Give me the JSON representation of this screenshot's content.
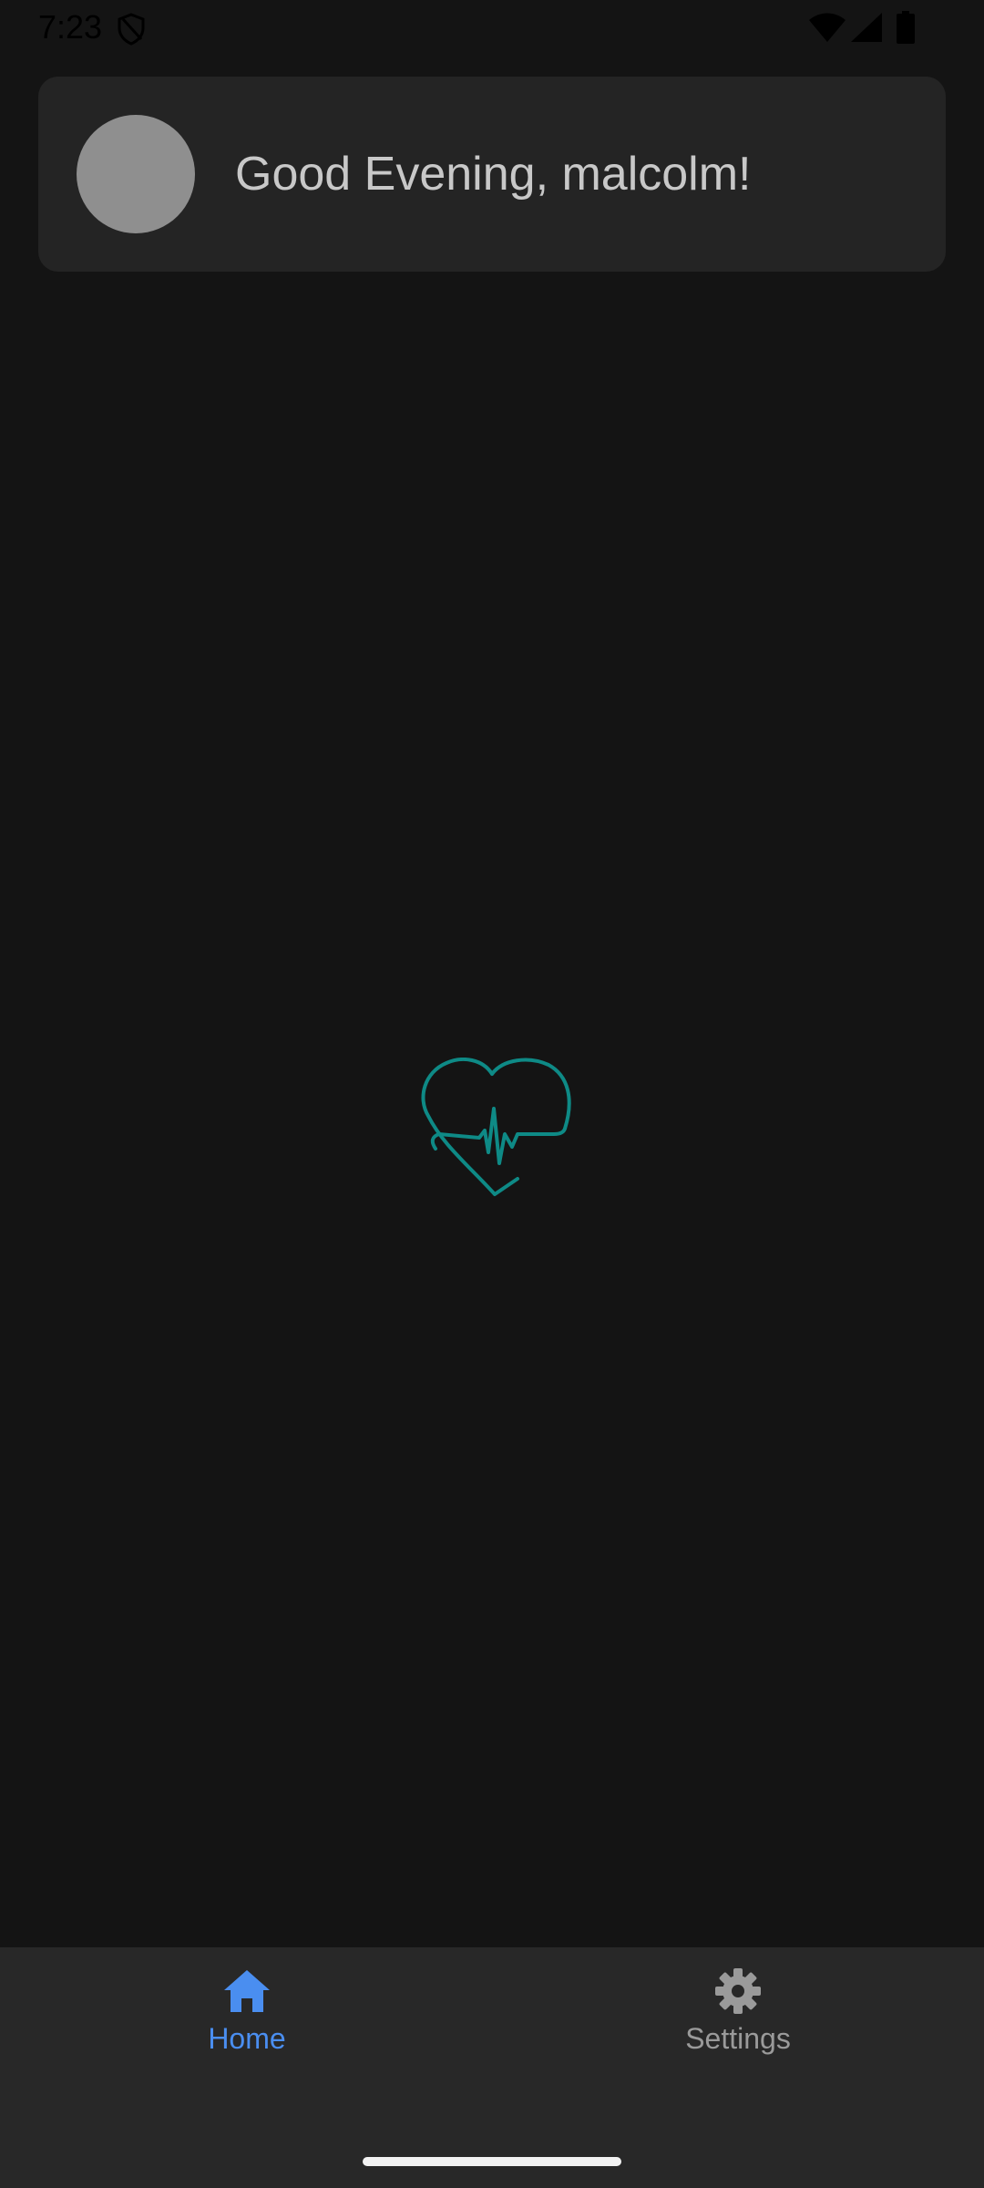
{
  "status_bar": {
    "time": "7:23",
    "icons": [
      "shield-icon",
      "wifi-icon",
      "signal-icon",
      "battery-icon"
    ]
  },
  "greeting_card": {
    "text": "Good Evening, malcolm!",
    "avatar_color": "#8f8f8f"
  },
  "center_logo": {
    "icon": "heart-pulse-icon",
    "color": "#0e8a86"
  },
  "bottom_nav": {
    "items": [
      {
        "label": "Home",
        "icon": "home-icon",
        "active": true,
        "color": "#4a8ef0"
      },
      {
        "label": "Settings",
        "icon": "gear-icon",
        "active": false,
        "color": "#9a9a9a"
      }
    ]
  },
  "colors": {
    "background": "#141414",
    "card": "#242424",
    "nav_background": "#282828",
    "accent": "#4a8ef0"
  }
}
